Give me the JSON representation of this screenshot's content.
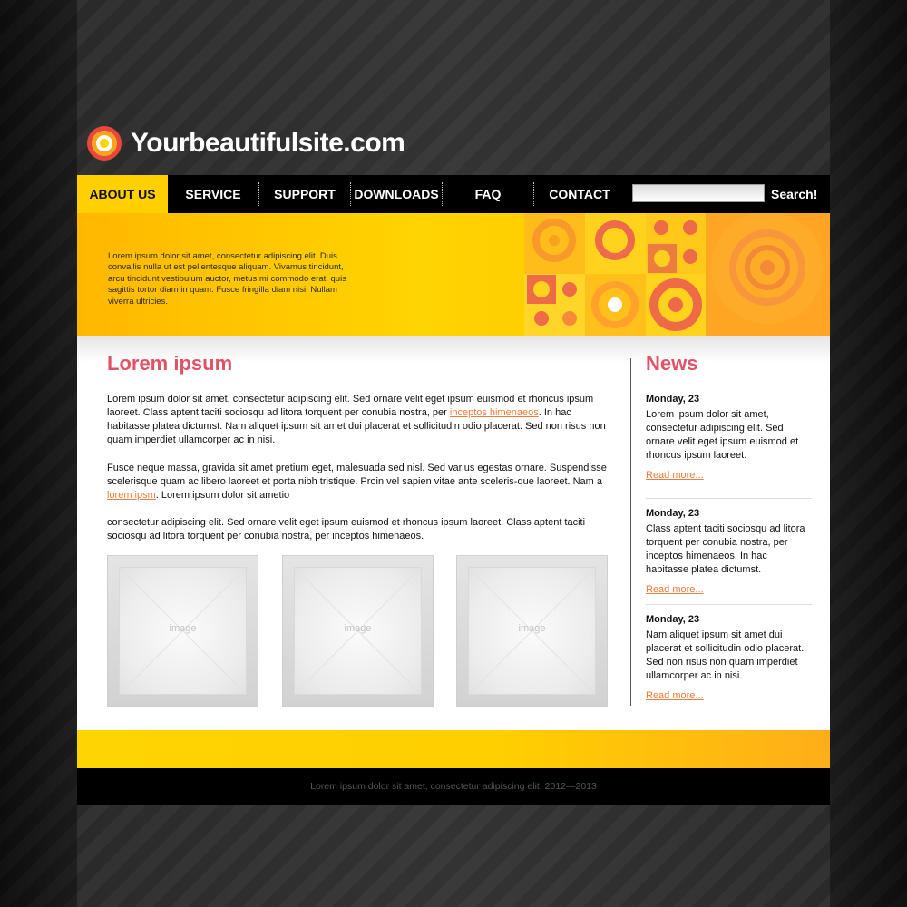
{
  "site": {
    "title": "Yourbeautifulsite.com"
  },
  "nav": {
    "items": [
      {
        "label": "ABOUT US",
        "active": true
      },
      {
        "label": "SERVICE"
      },
      {
        "label": "SUPPORT"
      },
      {
        "label": "DOWNLOADS"
      },
      {
        "label": "FAQ"
      },
      {
        "label": "CONTACT"
      }
    ],
    "search_value": "",
    "search_button": "Search!"
  },
  "banner": {
    "text": "Lorem ipsum dolor sit amet, consectetur adipiscing elit. Duis convallis nulla ut est pellentesque aliquam. Vivamus tincidunt, arcu tincidunt vestibulum auctor, metus mi commodo erat, quis sagittis tortor diam in quam. Fusce fringilla diam nisi. Nullam viverra ultricies."
  },
  "main": {
    "heading": "Lorem ipsum",
    "p1_before": "Lorem ipsum dolor sit amet, consectetur adipiscing elit. Sed ornare velit eget ipsum euismod et rhoncus ipsum laoreet. Class aptent taciti sociosqu ad litora torquent per conubia nostra, per ",
    "p1_link": "inceptos himenaeos",
    "p1_after": ". In hac habitasse platea dictumst. Nam aliquet ipsum sit amet dui placerat et sollicitudin odio placerat. Sed non risus non quam imperdiet ullamcorper ac in nisi.",
    "p2_before": "Fusce neque massa, gravida sit amet pretium eget, malesuada sed nisl. Sed varius egestas ornare. Suspendisse scelerisque quam ac libero laoreet et porta nibh tristique. Proin vel sapien vitae ante sceleris-que laoreet. Nam a ",
    "p2_link": "lorem ipsm",
    "p2_after": ". Lorem ipsum dolor sit ametio",
    "p3": "consectetur adipiscing elit. Sed ornare velit eget ipsum euismod et rhoncus ipsum laoreet. Class aptent taciti sociosqu ad litora torquent per conubia nostra, per inceptos himenaeos.",
    "image_label": "image"
  },
  "news": {
    "heading": "News",
    "items": [
      {
        "date": "Monday, 23",
        "text": "Lorem ipsum dolor sit amet, consectetur adipiscing elit. Sed ornare velit eget ipsum euismod et rhoncus ipsum laoreet.",
        "more": "Read more..."
      },
      {
        "date": "Monday, 23",
        "text": "Class aptent taciti sociosqu ad litora torquent per conubia nostra, per inceptos himenaeos. In hac habitasse platea dictumst.",
        "more": "Read more..."
      },
      {
        "date": "Monday, 23",
        "text": "Nam aliquet ipsum sit amet dui placerat et sollicitudin odio placerat. Sed non risus non quam imperdiet ullamcorper ac in nisi.",
        "more": "Read more..."
      }
    ]
  },
  "footer": {
    "text": "Lorem ipsum dolor sit amet, consectetur adipiscing elit. 2012—2013"
  },
  "colors": {
    "accent_yellow": "#ffd000",
    "accent_orange": "#ffae1a",
    "heading_pink": "#e25266",
    "link_orange": "#f07a3a"
  }
}
